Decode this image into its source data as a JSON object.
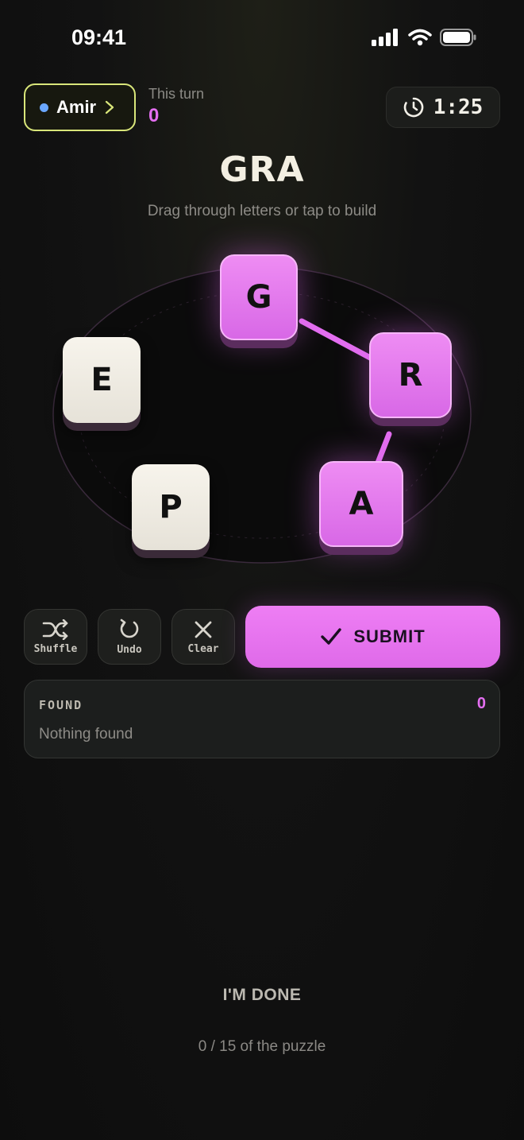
{
  "status_bar": {
    "time": "09:41",
    "icons": [
      "signal-icon",
      "wifi-icon",
      "battery-icon"
    ]
  },
  "player": {
    "name": "Amir",
    "dot_color": "#6aa7ff"
  },
  "turn": {
    "label": "This turn",
    "score": "0"
  },
  "timer": {
    "value": "1:25",
    "icon": "timer-icon"
  },
  "word": {
    "current": "GRA",
    "hint": "Drag through letters or tap to build"
  },
  "letters": [
    {
      "letter": "G",
      "state": "selected"
    },
    {
      "letter": "R",
      "state": "selected"
    },
    {
      "letter": "A",
      "state": "selected"
    },
    {
      "letter": "P",
      "state": "unselected"
    },
    {
      "letter": "E",
      "state": "unselected"
    }
  ],
  "actions": {
    "shuffle": {
      "label": "Shuffle",
      "icon": "shuffle-icon"
    },
    "undo": {
      "label": "Undo",
      "icon": "undo-icon"
    },
    "clear": {
      "label": "Clear",
      "icon": "close-icon"
    },
    "submit": {
      "label": "SUBMIT",
      "icon": "check-icon"
    }
  },
  "found": {
    "title": "FOUND",
    "count": "0",
    "empty_text": "Nothing found"
  },
  "footer": {
    "done_label": "I'M DONE",
    "progress": "0 / 15 of the puzzle"
  },
  "colors": {
    "accent": "#e36ef0",
    "player_border": "#d9e67a",
    "background": "#121212"
  }
}
